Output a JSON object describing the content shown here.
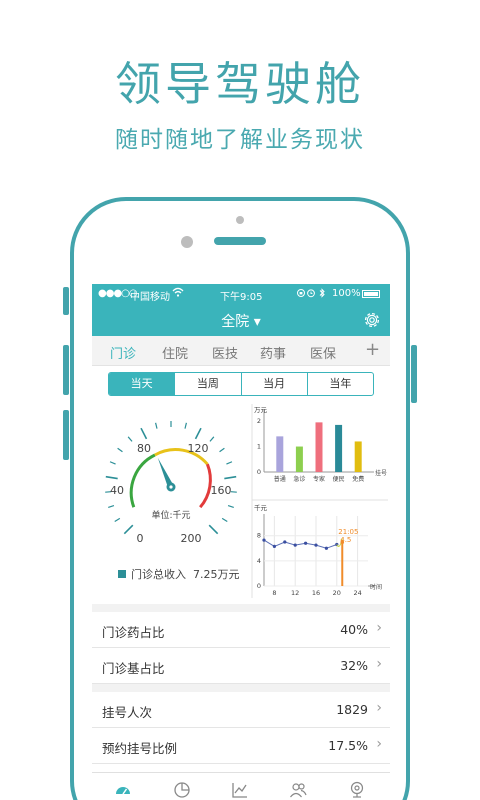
{
  "promo": {
    "title": "领导驾驶舱",
    "subtitle": "随时随地了解业务现状"
  },
  "statusbar": {
    "signal": "●●●○○",
    "carrier": "中国移动",
    "time": "下午9:05",
    "battery": "100%"
  },
  "navbar": {
    "title": "全院 ▾"
  },
  "tabs": [
    "门诊",
    "住院",
    "医技",
    "药事",
    "医保"
  ],
  "tabs_plus": "+",
  "period": [
    "当天",
    "当周",
    "当月",
    "当年"
  ],
  "gauge": {
    "unit_label": "单位:千元",
    "ticks": [
      "0",
      "40",
      "80",
      "120",
      "160",
      "200"
    ],
    "value": 7.25
  },
  "legend": {
    "label": "门诊总收入",
    "value": "7.25万元"
  },
  "chart_data": [
    {
      "type": "bar",
      "ylabel": "万元",
      "xlabel": "挂号",
      "categories": [
        "普通",
        "急诊",
        "专家",
        "便民",
        "免费"
      ],
      "values": [
        1.4,
        1.0,
        1.95,
        1.85,
        1.2
      ],
      "ylim": [
        0,
        2.2
      ],
      "yticks": [
        "0",
        "1",
        "2"
      ],
      "colors": [
        "#a9a4dc",
        "#8dcf4f",
        "#ef6f7d",
        "#2a8a98",
        "#e1bd10"
      ]
    },
    {
      "type": "line",
      "ylabel": "千元",
      "xlabel": "时间",
      "x": [
        6,
        8,
        10,
        12,
        14,
        16,
        18,
        20,
        21.05
      ],
      "values": [
        7.3,
        6.3,
        7.0,
        6.5,
        6.8,
        6.5,
        6.0,
        6.6,
        7.6
      ],
      "ylim": [
        0,
        10.5
      ],
      "yticks": [
        "0",
        "4",
        "8"
      ],
      "xticks": [
        "8",
        "12",
        "16",
        "20",
        "24"
      ],
      "marker": {
        "time": "21:05",
        "value": "4.5"
      }
    }
  ],
  "rows": [
    {
      "label": "门诊药占比",
      "value": "40%"
    },
    {
      "label": "门诊基占比",
      "value": "32%"
    },
    {
      "label": "挂号人次",
      "value": "1829"
    },
    {
      "label": "预约挂号比例",
      "value": "17.5%"
    }
  ],
  "colors": {
    "accent": "#3ab4bb",
    "promo": "#43a4ac"
  }
}
